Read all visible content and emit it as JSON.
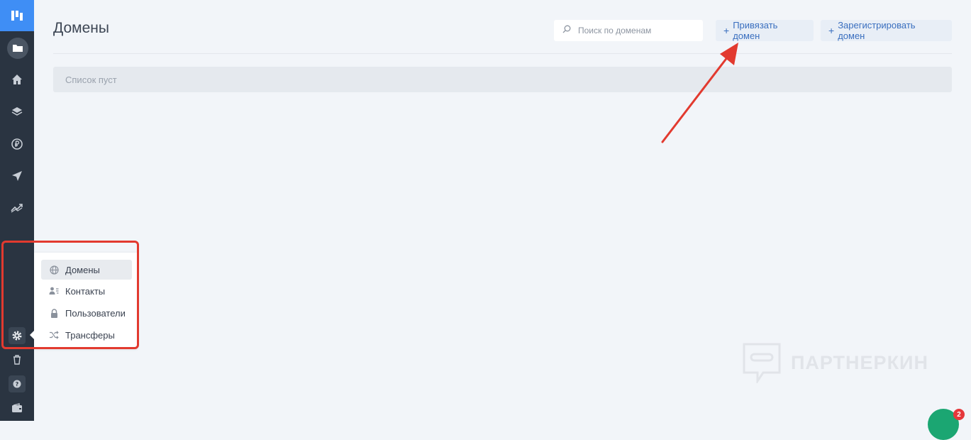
{
  "sidebar": {
    "logo_icon": "brand-logo-icon",
    "icons": [
      "folder-icon",
      "home-icon",
      "layers-icon",
      "currency-icon",
      "send-icon",
      "trend-icon",
      "gear-icon",
      "trash-icon",
      "help-icon",
      "wallet-icon"
    ],
    "accent": "#3f8ef5"
  },
  "header": {
    "title": "Домены",
    "search_placeholder": "Поиск по доменам",
    "bind_button": "Привязать домен",
    "register_button": "Зарегистрировать домен",
    "plus": "+"
  },
  "content": {
    "empty_text": "Список пуст"
  },
  "settings_menu": {
    "items": [
      {
        "label": "Домены",
        "icon": "globe-icon"
      },
      {
        "label": "Контакты",
        "icon": "contacts-icon"
      },
      {
        "label": "Пользователи",
        "icon": "lock-icon"
      },
      {
        "label": "Трансферы",
        "icon": "shuffle-icon"
      }
    ]
  },
  "annotation": {
    "color": "#e23a2f"
  },
  "watermark": {
    "text": "ПАРТНЕРКИН"
  },
  "chat": {
    "badge_count": "2",
    "color": "#1ba672"
  }
}
